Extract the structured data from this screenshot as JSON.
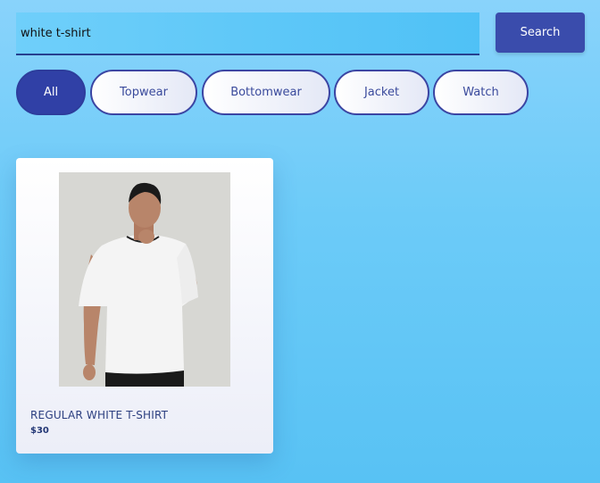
{
  "search": {
    "value": "white t-shirt",
    "button_label": "Search"
  },
  "filters": [
    {
      "label": "All",
      "active": true
    },
    {
      "label": "Topwear",
      "active": false
    },
    {
      "label": "Bottomwear",
      "active": false
    },
    {
      "label": "Jacket",
      "active": false
    },
    {
      "label": "Watch",
      "active": false
    }
  ],
  "products": [
    {
      "name": "REGULAR WHITE T-SHIRT",
      "price": "$30",
      "image": "man-wearing-white-tshirt"
    }
  ],
  "colors": {
    "accent": "#3a4cac",
    "background": "#6ccbf8"
  }
}
